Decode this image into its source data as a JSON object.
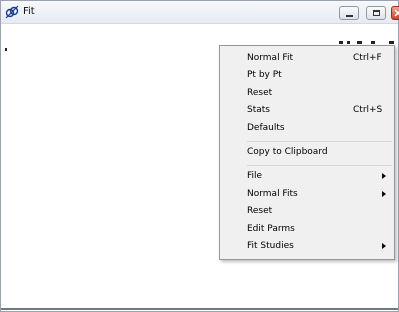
{
  "window": {
    "title": "Fit",
    "icons": {
      "app": "fit-app-icon",
      "minimize": "minimize-icon",
      "maximize": "maximize-icon",
      "close": "close-icon"
    }
  },
  "menu": {
    "group1": [
      {
        "label": "Normal Fit",
        "shortcut": "Ctrl+F"
      },
      {
        "label": "Pt by Pt",
        "shortcut": ""
      },
      {
        "label": "Reset",
        "shortcut": ""
      },
      {
        "label": "Stats",
        "shortcut": "Ctrl+S"
      },
      {
        "label": "Defaults",
        "shortcut": ""
      }
    ],
    "group2": [
      {
        "label": "Copy to Clipboard"
      }
    ],
    "group3": [
      {
        "label": "File",
        "submenu": true
      },
      {
        "label": "Normal Fits",
        "submenu": true
      },
      {
        "label": "Reset",
        "submenu": false
      },
      {
        "label": "Edit Parms",
        "submenu": false
      },
      {
        "label": "Fit Studies",
        "submenu": true
      }
    ]
  },
  "colors": {
    "menu_bg": "#f0f0f0",
    "close_button": "#c8442d"
  }
}
